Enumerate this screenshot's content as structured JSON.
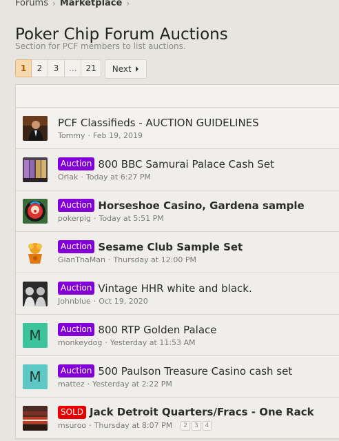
{
  "breadcrumb": {
    "items": [
      "Forums",
      "Marketplace"
    ]
  },
  "page": {
    "title": "Poker Chip Forum Auctions",
    "description": "Section for PCF members to list auctions."
  },
  "pagination": {
    "pages": [
      "1",
      "2",
      "3",
      "...",
      "21"
    ],
    "current": "1",
    "next_label": "Next"
  },
  "colors": {
    "auction_prefix": "#8200d6",
    "sold_prefix": "#e60000",
    "accent": "#b05a00"
  },
  "threads": [
    {
      "title": "PCF Classifieds - AUCTION GUIDELINES",
      "prefix": "",
      "author": "Tommy",
      "date": "Feb 19, 2019",
      "bold": false,
      "avatar": "photo-man-in-suit"
    },
    {
      "title": "800 BBC Samurai Palace Cash Set",
      "prefix": "Auction",
      "author": "Orlak",
      "date": "Today at 6:27 PM",
      "bold": false,
      "avatar": "photo-chip-racks"
    },
    {
      "title": "Horseshoe Casino, Gardena sample",
      "prefix": "Auction",
      "author": "pokerpig",
      "date": "Today at 5:51 PM",
      "bold": true,
      "avatar": "photo-clown"
    },
    {
      "title": "Sesame Club Sample Set",
      "prefix": "Auction",
      "author": "GianThaMan",
      "date": "Thursday at 12:00 PM",
      "bold": true,
      "avatar": "photo-muppet"
    },
    {
      "title": "Vintage HHR white and black.",
      "prefix": "Auction",
      "author": "Johnblue",
      "date": "Oct 19, 2020",
      "bold": false,
      "avatar": "photo-black-white-men"
    },
    {
      "title": "800 RTP Golden Palace",
      "prefix": "Auction",
      "author": "monkeydog",
      "date": "Yesterday at 11:53 AM",
      "bold": false,
      "avatar_letter": "M",
      "avatar_color": "#3cc39b"
    },
    {
      "title": "500 Paulson Treasure Casino cash set",
      "prefix": "Auction",
      "author": "mattez",
      "date": "Yesterday at 2:22 PM",
      "bold": false,
      "avatar_letter": "M",
      "avatar_color": "#5ec9c4"
    },
    {
      "title": "Jack Detroit Quarters/Fracs - One Rack",
      "prefix": "SOLD",
      "author": "msuroo",
      "date": "Thursday at 8:07 PM",
      "bold": true,
      "avatar": "photo-red-chips",
      "pages": [
        "2",
        "3",
        "4"
      ]
    }
  ]
}
